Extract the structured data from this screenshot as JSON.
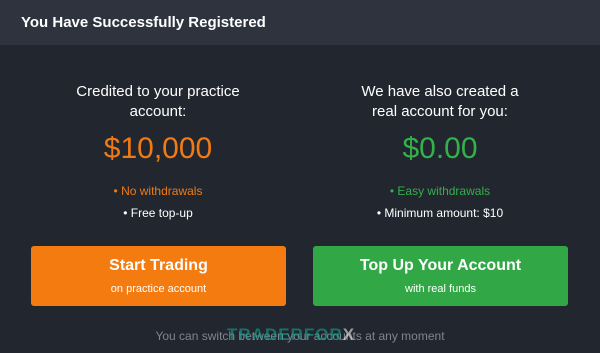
{
  "dialog": {
    "title": "You Have Successfully Registered"
  },
  "practice": {
    "heading_line1": "Credited to your practice",
    "heading_line2": "account:",
    "amount": "$10,000",
    "feature1": "• No withdrawals",
    "feature2": "• Free top-up"
  },
  "real": {
    "heading_line1": "We have also created a",
    "heading_line2": "real account for you:",
    "amount": "$0.00",
    "feature1": "• Easy withdrawals",
    "feature2": "• Minimum amount:  $10"
  },
  "buttons": {
    "start_trading": {
      "label": "Start Trading",
      "sublabel": "on practice account"
    },
    "top_up": {
      "label": "Top Up Your Account",
      "sublabel": "with real funds"
    }
  },
  "footer": {
    "text": "You can switch between your accounts at any moment"
  },
  "watermark": {
    "part1": "TRADERFOR",
    "part2": "X"
  },
  "colors": {
    "background": "#22262f",
    "header": "#2e333e",
    "orange": "#f37b10",
    "green": "#31a845"
  }
}
